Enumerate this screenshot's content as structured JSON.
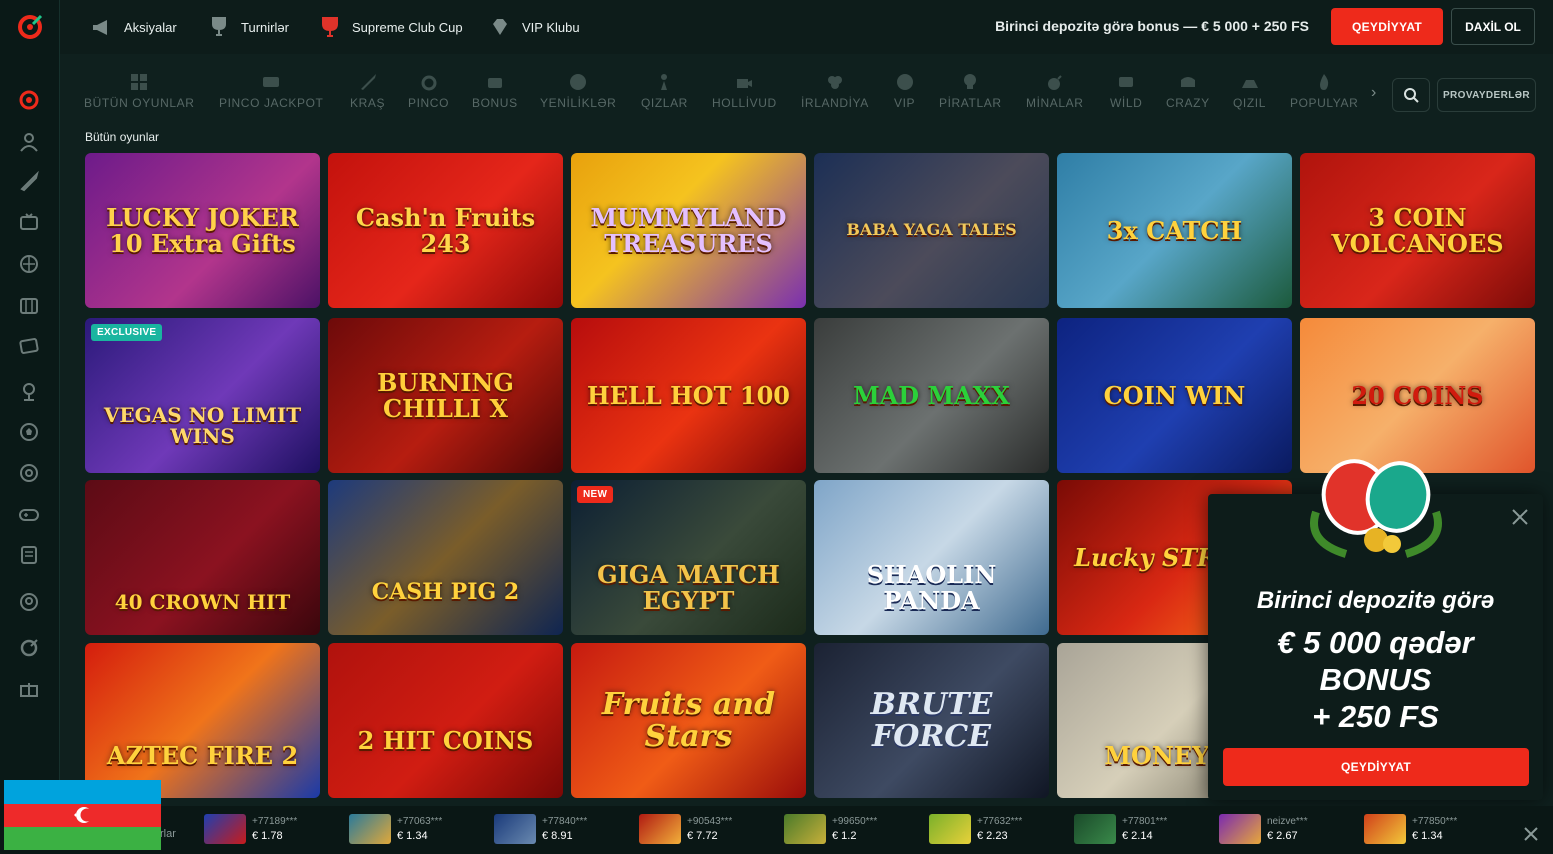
{
  "header": {
    "nav": [
      {
        "label": "Aksiyalar",
        "icon": "megaphone-icon"
      },
      {
        "label": "Turnirlər",
        "icon": "trophy-icon"
      },
      {
        "label": "Supreme Club Cup",
        "icon": "cup-icon"
      },
      {
        "label": "VIP Klubu",
        "icon": "diamond-icon"
      }
    ],
    "promo": "Birinci depozitə görə bonus — € 5 000 + 250 FS",
    "register": "QEYDİYYAT",
    "login": "DAXİL OL"
  },
  "categories": [
    "BÜTÜN OYUNLAR",
    "PINCO JACKPOT",
    "KRAŞ",
    "PINCO",
    "BONUS",
    "YENİLİKLƏR",
    "QIZLAR",
    "HOLLİVUD",
    "İRLANDİYA",
    "VIP",
    "PİRATLAR",
    "MİNALAR",
    "WİLD",
    "CRAZY",
    "QIZIL",
    "POPULYAR"
  ],
  "providers_label": "PROVAYDERLƏR",
  "section_title": "Bütün oyunlar",
  "games": [
    {
      "name": "LUCKY JOKER 10 Extra Gifts",
      "tag": ""
    },
    {
      "name": "Cash'n Fruits 243",
      "tag": ""
    },
    {
      "name": "MUMMYLAND TREASURES",
      "tag": ""
    },
    {
      "name": "BABA YAGA TALES",
      "tag": ""
    },
    {
      "name": "3x CATCH",
      "tag": ""
    },
    {
      "name": "3 COIN VOLCANOES",
      "tag": ""
    },
    {
      "name": "VEGAS NO LIMIT WINS",
      "tag": "EXCLUSIVE"
    },
    {
      "name": "BURNING CHILLI X",
      "tag": ""
    },
    {
      "name": "HELL HOT 100",
      "tag": ""
    },
    {
      "name": "MAD MAXX",
      "tag": ""
    },
    {
      "name": "COIN WIN",
      "tag": ""
    },
    {
      "name": "20 COINS",
      "tag": ""
    },
    {
      "name": "40 CROWN HIT",
      "tag": ""
    },
    {
      "name": "CASH PIG 2",
      "tag": ""
    },
    {
      "name": "GIGA MATCH EGYPT",
      "tag": "NEW"
    },
    {
      "name": "SHAOLIN PANDA",
      "tag": ""
    },
    {
      "name": "Lucky STREAK",
      "tag": ""
    },
    {
      "name": "",
      "tag": ""
    },
    {
      "name": "AZTEC FIRE 2",
      "tag": ""
    },
    {
      "name": "2 HIT COINS",
      "tag": ""
    },
    {
      "name": "Fruits and Stars",
      "tag": ""
    },
    {
      "name": "BRUTE FORCE",
      "tag": ""
    },
    {
      "name": "MONEYFE",
      "tag": ""
    }
  ],
  "popup": {
    "line1": "Birinci depozitə görə",
    "line2": "€ 5 000 qədər",
    "line3": "BONUS",
    "line4": "+ 250 FS",
    "button": "QEYDİYYAT"
  },
  "ticker": {
    "label": "rlar",
    "items": [
      {
        "user": "+77189***",
        "amount": "€ 1.78"
      },
      {
        "user": "+77063***",
        "amount": "€ 1.34"
      },
      {
        "user": "+77840***",
        "amount": "€ 8.91"
      },
      {
        "user": "+90543***",
        "amount": "€ 7.72"
      },
      {
        "user": "+99650***",
        "amount": "€ 1.2"
      },
      {
        "user": "+77632***",
        "amount": "€ 2.23"
      },
      {
        "user": "+77801***",
        "amount": "€ 2.14"
      },
      {
        "user": "neizve***",
        "amount": "€ 2.67"
      },
      {
        "user": "+77850***",
        "amount": "€ 1.34"
      }
    ]
  },
  "colors": {
    "accent": "#ee2a1b",
    "background": "#0f201e"
  }
}
